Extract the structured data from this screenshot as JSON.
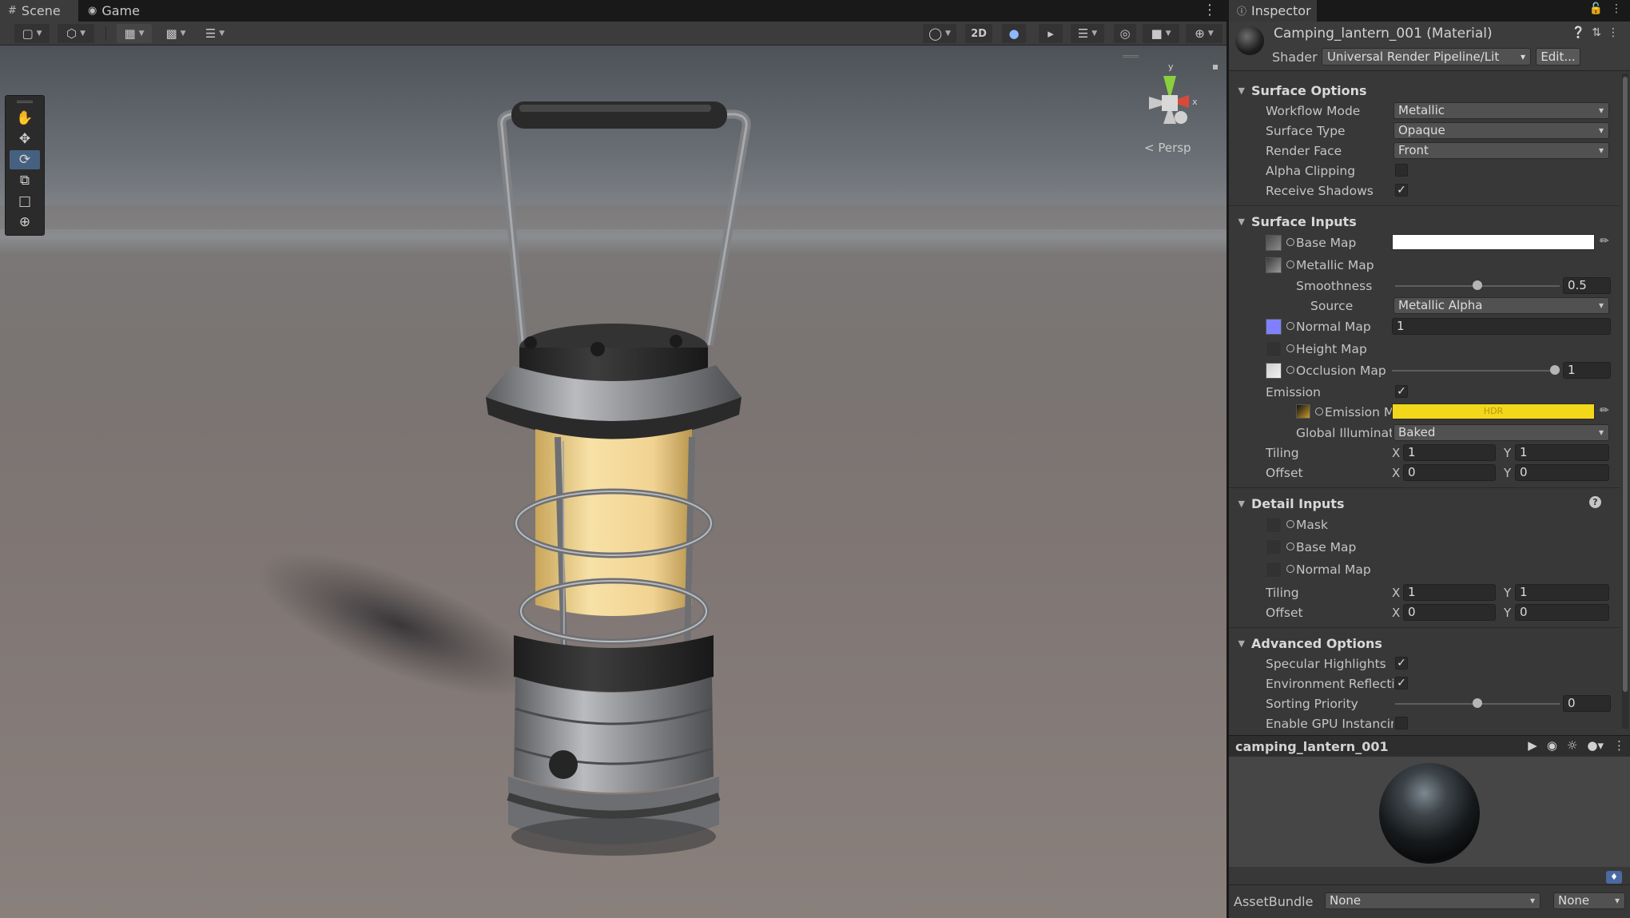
{
  "scene_tabs": {
    "scene": "Scene",
    "game": "Game"
  },
  "scene_toolbar": {
    "two_d": "2D"
  },
  "viewport": {
    "persp_label": "< Persp",
    "gizmo_y": "y",
    "gizmo_x": "x"
  },
  "inspector": {
    "tab": "Inspector",
    "material_title": "Camping_lantern_001 (Material)",
    "shader_label": "Shader",
    "shader_value": "Universal Render Pipeline/Lit",
    "edit_button": "Edit..."
  },
  "surface_options": {
    "title": "Surface Options",
    "workflow_mode": {
      "label": "Workflow Mode",
      "value": "Metallic"
    },
    "surface_type": {
      "label": "Surface Type",
      "value": "Opaque"
    },
    "render_face": {
      "label": "Render Face",
      "value": "Front"
    },
    "alpha_clipping": {
      "label": "Alpha Clipping",
      "checked": false
    },
    "receive_shadows": {
      "label": "Receive Shadows",
      "checked": true
    }
  },
  "surface_inputs": {
    "title": "Surface Inputs",
    "base_map": {
      "label": "Base Map",
      "color": "#ffffff"
    },
    "metallic_map": {
      "label": "Metallic Map"
    },
    "smoothness": {
      "label": "Smoothness",
      "value": "0.5",
      "fraction": 0.5
    },
    "source": {
      "label": "Source",
      "value": "Metallic Alpha"
    },
    "normal_map": {
      "label": "Normal Map",
      "value": "1"
    },
    "height_map": {
      "label": "Height Map"
    },
    "occlusion_map": {
      "label": "Occlusion Map",
      "value": "1",
      "fraction": 1.0
    },
    "emission": {
      "label": "Emission",
      "checked": true
    },
    "emission_map": {
      "label": "Emission M",
      "color": "#f3d71a",
      "hdr": "HDR"
    },
    "global_illumination": {
      "label": "Global Illuminatic",
      "value": "Baked"
    },
    "tiling": {
      "label": "Tiling",
      "x": "1",
      "y": "1"
    },
    "offset": {
      "label": "Offset",
      "x": "0",
      "y": "0"
    }
  },
  "detail_inputs": {
    "title": "Detail Inputs",
    "mask": "Mask",
    "base_map": "Base Map",
    "normal_map": "Normal Map",
    "tiling": {
      "label": "Tiling",
      "x": "1",
      "y": "1"
    },
    "offset": {
      "label": "Offset",
      "x": "0",
      "y": "0"
    }
  },
  "advanced_options": {
    "title": "Advanced Options",
    "specular_highlights": {
      "label": "Specular Highlights",
      "checked": true
    },
    "environment_reflections": {
      "label": "Environment Reflectio",
      "checked": true
    },
    "sorting_priority": {
      "label": "Sorting Priority",
      "value": "0",
      "fraction": 0.5
    },
    "gpu_instancing": {
      "label": "Enable GPU Instancin",
      "checked": false
    }
  },
  "axis_labels": {
    "x": "X",
    "y": "Y"
  },
  "help_glyph": "?",
  "preview": {
    "title": "camping_lantern_001"
  },
  "asset_bundle": {
    "label": "AssetBundle",
    "name": "None",
    "variant": "None"
  },
  "colors": {
    "accent_blue": "#46607f",
    "emission_yellow": "#f3d71a",
    "lantern_glow": "#f1d393"
  }
}
